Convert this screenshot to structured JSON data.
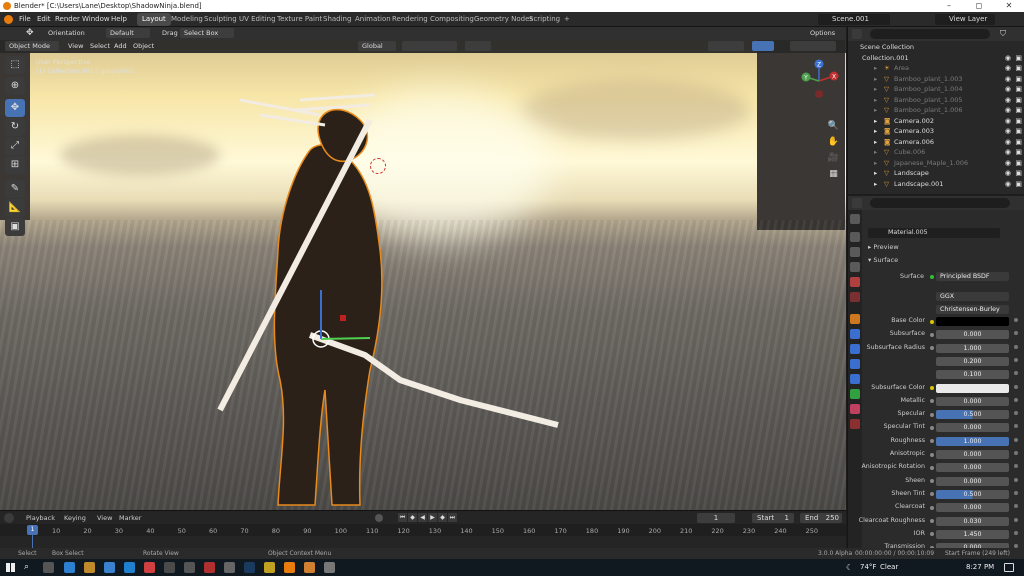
{
  "titlebar": {
    "title": "Blender* [C:\\Users\\Lane\\Desktop\\ShadowNinja.blend]",
    "minimize": "–",
    "maximize": "◻",
    "close": "✕"
  },
  "menu": [
    "File",
    "Edit",
    "Render",
    "Window",
    "Help"
  ],
  "workspaces": [
    "Layout",
    "Modeling",
    "Sculpting",
    "UV Editing",
    "Texture Paint",
    "Shading",
    "Animation",
    "Rendering",
    "Compositing",
    "Geometry Nodes",
    "Scripting"
  ],
  "active_workspace": "Layout",
  "add_workspace": "+",
  "scene": "Scene.001",
  "view_layer": "View Layer",
  "toolbar": {
    "orientation_label": "Orientation",
    "orientation_value": "Default",
    "drag_label": "Drag",
    "drag_value": "Select Box",
    "options": "Options"
  },
  "viewport_header": {
    "mode": "Object Mode",
    "view": "View",
    "select": "Select",
    "add": "Add",
    "object": "Object",
    "transform": "Global"
  },
  "viewport_overlay": {
    "line1": "User Perspective",
    "line2": "(1) Collection.001 | galaxy002"
  },
  "gizmo": {
    "x": "X",
    "y": "Y",
    "z": "Z"
  },
  "outliner": {
    "root": "Scene Collection",
    "collection": "Collection.001",
    "items": [
      {
        "name": "Area",
        "dim": true,
        "icon": "light-icon"
      },
      {
        "name": "Bamboo_plant_1.003",
        "dim": true,
        "icon": "mesh-icon"
      },
      {
        "name": "Bamboo_plant_1.004",
        "dim": true,
        "icon": "mesh-icon"
      },
      {
        "name": "Bamboo_plant_1.005",
        "dim": true,
        "icon": "mesh-icon"
      },
      {
        "name": "Bamboo_plant_1.006",
        "dim": true,
        "icon": "mesh-icon"
      },
      {
        "name": "Camera.002",
        "dim": false,
        "icon": "camera-icon"
      },
      {
        "name": "Camera.003",
        "dim": false,
        "icon": "camera-icon"
      },
      {
        "name": "Camera.006",
        "dim": false,
        "icon": "camera-icon"
      },
      {
        "name": "Cube.006",
        "dim": true,
        "icon": "mesh-icon"
      },
      {
        "name": "Japanese_Maple_1.006",
        "dim": true,
        "icon": "mesh-icon"
      },
      {
        "name": "Landscape",
        "dim": false,
        "icon": "mesh-icon"
      },
      {
        "name": "Landscape.001",
        "dim": false,
        "icon": "mesh-icon"
      }
    ]
  },
  "properties": {
    "material": "Material.005",
    "preview": "Preview",
    "surface_section": "Surface",
    "surface_label": "Surface",
    "surface_value": "Principled BSDF",
    "distribution": "GGX",
    "subsurface_method": "Christensen-Burley",
    "rows": [
      {
        "label": "Base Color",
        "value": "",
        "kind": "color-black"
      },
      {
        "label": "Subsurface",
        "value": "0.000",
        "kind": "num"
      },
      {
        "label": "Subsurface Radius",
        "value": "1.000",
        "kind": "num"
      },
      {
        "label": "",
        "value": "0.200",
        "kind": "num"
      },
      {
        "label": "",
        "value": "0.100",
        "kind": "num"
      },
      {
        "label": "Subsurface Color",
        "value": "",
        "kind": "color-white"
      },
      {
        "label": "Metallic",
        "value": "0.000",
        "kind": "num"
      },
      {
        "label": "Specular",
        "value": "0.500",
        "kind": "half"
      },
      {
        "label": "Specular Tint",
        "value": "0.000",
        "kind": "num"
      },
      {
        "label": "Roughness",
        "value": "1.000",
        "kind": "full"
      },
      {
        "label": "Anisotropic",
        "value": "0.000",
        "kind": "num"
      },
      {
        "label": "Anisotropic Rotation",
        "value": "0.000",
        "kind": "num"
      },
      {
        "label": "Sheen",
        "value": "0.000",
        "kind": "num"
      },
      {
        "label": "Sheen Tint",
        "value": "0.500",
        "kind": "half"
      },
      {
        "label": "Clearcoat",
        "value": "0.000",
        "kind": "num"
      },
      {
        "label": "Clearcoat Roughness",
        "value": "0.030",
        "kind": "num"
      },
      {
        "label": "IOR",
        "value": "1.450",
        "kind": "num"
      },
      {
        "label": "Transmission",
        "value": "0.000",
        "kind": "num"
      }
    ]
  },
  "timeline": {
    "menu": [
      "Playback",
      "Keying",
      "View",
      "Marker"
    ],
    "current_frame": "1",
    "start_label": "Start",
    "start": "1",
    "end_label": "End",
    "end": "250",
    "ticks": [
      "10",
      "20",
      "30",
      "40",
      "50",
      "60",
      "70",
      "80",
      "90",
      "100",
      "110",
      "120",
      "130",
      "140",
      "150",
      "160",
      "170",
      "180",
      "190",
      "200",
      "210",
      "220",
      "230",
      "240",
      "250"
    ],
    "playhead": "1"
  },
  "statusbar": {
    "select": "Select",
    "box_select": "Box Select",
    "rotate_view": "Rotate View",
    "context_menu": "Object Context Menu",
    "version": "3.0.0 Alpha",
    "timecode": "00:00:00:00 / 00:00:10:09",
    "frame_range": "Start Frame (249 left)"
  },
  "taskbar": {
    "weather_temp": "74°F",
    "weather_text": "Clear",
    "time": "8:27 PM",
    "start_icon": "windows-icon"
  },
  "colors": {
    "accent": "#4772b3",
    "orange": "#e87d0d"
  }
}
